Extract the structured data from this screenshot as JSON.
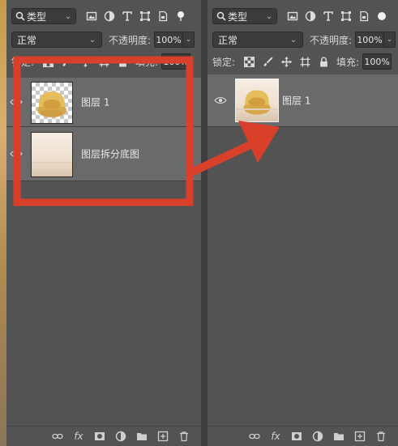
{
  "colors": {
    "annotation": "#d8402a",
    "panel": "#535353",
    "selected_layer": "#6a6a6a",
    "field": "#3b3b3b"
  },
  "left_panel": {
    "filter": {
      "label": "类型"
    },
    "blend_mode": "正常",
    "opacity_label": "不透明度:",
    "opacity_value": "100%",
    "lock_label": "锁定:",
    "fill_label": "填充:",
    "fill_value": "100%",
    "layers": [
      {
        "name": "图层 1",
        "thumbnail": "sofa-on-transparent",
        "visible": true
      },
      {
        "name": "图层拆分底图",
        "thumbnail": "room-background",
        "visible": true
      }
    ]
  },
  "right_panel": {
    "filter": {
      "label": "类型"
    },
    "blend_mode": "正常",
    "opacity_label": "不透明度:",
    "opacity_value": "100%",
    "lock_label": "锁定:",
    "fill_label": "填充:",
    "fill_value": "100%",
    "layers": [
      {
        "name": "图层 1",
        "thumbnail": "sofa-on-room",
        "visible": true
      }
    ]
  },
  "icons": {
    "filter_icons": [
      "image-filter-icon",
      "adjustment-filter-icon",
      "type-filter-icon",
      "shape-filter-icon",
      "smart-object-filter-icon",
      "filter-toggle-icon"
    ],
    "lock_icons": [
      "lock-transparent-icon",
      "lock-brush-icon",
      "lock-move-icon",
      "lock-artboard-icon",
      "lock-all-icon"
    ],
    "bottom_icons": [
      "link-icon",
      "fx-icon",
      "mask-icon",
      "adjustment-layer-icon",
      "group-folder-icon",
      "new-layer-icon",
      "trash-icon"
    ],
    "bottom_fx_text": "fx"
  }
}
